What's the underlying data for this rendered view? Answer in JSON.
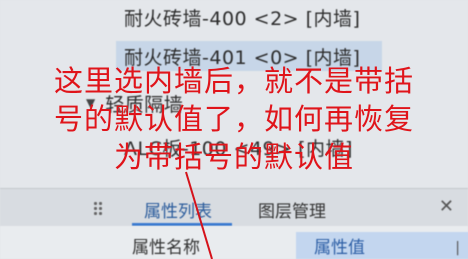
{
  "tree": {
    "items": [
      {
        "label": "耐火砖墙-400 <2> [内墙]"
      },
      {
        "label": "耐火砖墙-401 <0> [内墙]",
        "selected": true
      },
      {
        "label": "轻质隔墙",
        "type": "group"
      },
      {
        "label": "ALC板-100 <49> [内墙]"
      }
    ],
    "group_caret": "▼"
  },
  "annotation": {
    "lines": [
      "这里选内墙后，就不是带括",
      "号的默认值了，如何再恢复",
      "为带括号的默认值"
    ],
    "color": "#e0141a"
  },
  "panel": {
    "tabs": [
      {
        "label": "属性列表",
        "active": true
      },
      {
        "label": "图层管理",
        "active": false
      }
    ],
    "close_glyph": "✕"
  },
  "table": {
    "headers": [
      "属性名称",
      "属性值"
    ],
    "column_divider": "|"
  }
}
